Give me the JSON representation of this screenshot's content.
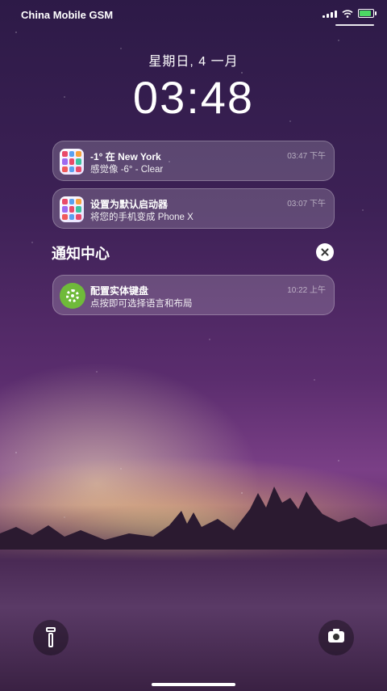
{
  "statusbar": {
    "carrier": "China Mobile GSM"
  },
  "lockscreen": {
    "date": "星期日, 4 一月",
    "time": "03:48"
  },
  "notifications": [
    {
      "title": "-1° 在 New York",
      "body": "感觉像 -6° - Clear",
      "time": "03:47 下午",
      "app_icon": "launcher-icon"
    },
    {
      "title": "设置为默认启动器",
      "body": "将您的手机变成 Phone X",
      "time": "03:07 下午",
      "app_icon": "launcher-icon"
    }
  ],
  "notification_center": {
    "title": "通知中心",
    "items": [
      {
        "title": "配置实体键盘",
        "body": "点按即可选择语言和布局",
        "time": "10:22 上午",
        "app_icon": "settings-gear-icon",
        "icon_color": "#6fba3a"
      }
    ]
  },
  "quick_actions": {
    "left": "flashlight-icon",
    "right": "camera-icon"
  },
  "colors": {
    "card_bg": "rgba(255,255,255,0.18)",
    "battery": "#4cd964"
  }
}
